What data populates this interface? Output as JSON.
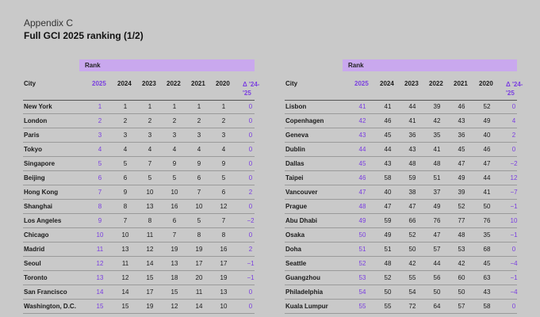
{
  "header": {
    "appendix": "Appendix C",
    "title": "Full GCI 2025 ranking (1/2)"
  },
  "table": {
    "rank_label": "Rank",
    "city_label": "City",
    "columns": [
      "2025",
      "2024",
      "2023",
      "2022",
      "2021",
      "2020",
      "Δ '24-'25"
    ],
    "left_rows": [
      {
        "city": "New York",
        "v": [
          "1",
          "1",
          "1",
          "1",
          "1",
          "1",
          "0"
        ]
      },
      {
        "city": "London",
        "v": [
          "2",
          "2",
          "2",
          "2",
          "2",
          "2",
          "0"
        ]
      },
      {
        "city": "Paris",
        "v": [
          "3",
          "3",
          "3",
          "3",
          "3",
          "3",
          "0"
        ]
      },
      {
        "city": "Tokyo",
        "v": [
          "4",
          "4",
          "4",
          "4",
          "4",
          "4",
          "0"
        ]
      },
      {
        "city": "Singapore",
        "v": [
          "5",
          "5",
          "7",
          "9",
          "9",
          "9",
          "0"
        ]
      },
      {
        "city": "Beijing",
        "v": [
          "6",
          "6",
          "5",
          "5",
          "6",
          "5",
          "0"
        ]
      },
      {
        "city": "Hong Kong",
        "v": [
          "7",
          "9",
          "10",
          "10",
          "7",
          "6",
          "2"
        ]
      },
      {
        "city": "Shanghai",
        "v": [
          "8",
          "8",
          "13",
          "16",
          "10",
          "12",
          "0"
        ]
      },
      {
        "city": "Los Angeles",
        "v": [
          "9",
          "7",
          "8",
          "6",
          "5",
          "7",
          "−2"
        ]
      },
      {
        "city": "Chicago",
        "v": [
          "10",
          "10",
          "11",
          "7",
          "8",
          "8",
          "0"
        ]
      },
      {
        "city": "Madrid",
        "v": [
          "11",
          "13",
          "12",
          "19",
          "19",
          "16",
          "2"
        ]
      },
      {
        "city": "Seoul",
        "v": [
          "12",
          "11",
          "14",
          "13",
          "17",
          "17",
          "−1"
        ]
      },
      {
        "city": "Toronto",
        "v": [
          "13",
          "12",
          "15",
          "18",
          "20",
          "19",
          "−1"
        ]
      },
      {
        "city": "San Francisco",
        "v": [
          "14",
          "14",
          "17",
          "15",
          "11",
          "13",
          "0"
        ]
      },
      {
        "city": "Washington, D.C.",
        "v": [
          "15",
          "15",
          "19",
          "12",
          "14",
          "10",
          "0"
        ]
      }
    ],
    "right_rows": [
      {
        "city": "Lisbon",
        "v": [
          "41",
          "41",
          "44",
          "39",
          "46",
          "52",
          "0"
        ]
      },
      {
        "city": "Copenhagen",
        "v": [
          "42",
          "46",
          "41",
          "42",
          "43",
          "49",
          "4"
        ]
      },
      {
        "city": "Geneva",
        "v": [
          "43",
          "45",
          "36",
          "35",
          "36",
          "40",
          "2"
        ]
      },
      {
        "city": "Dublin",
        "v": [
          "44",
          "44",
          "43",
          "41",
          "45",
          "46",
          "0"
        ]
      },
      {
        "city": "Dallas",
        "v": [
          "45",
          "43",
          "48",
          "48",
          "47",
          "47",
          "−2"
        ]
      },
      {
        "city": "Taipei",
        "v": [
          "46",
          "58",
          "59",
          "51",
          "49",
          "44",
          "12"
        ]
      },
      {
        "city": "Vancouver",
        "v": [
          "47",
          "40",
          "38",
          "37",
          "39",
          "41",
          "−7"
        ]
      },
      {
        "city": "Prague",
        "v": [
          "48",
          "47",
          "47",
          "49",
          "52",
          "50",
          "−1"
        ]
      },
      {
        "city": "Abu Dhabi",
        "v": [
          "49",
          "59",
          "66",
          "76",
          "77",
          "76",
          "10"
        ]
      },
      {
        "city": "Osaka",
        "v": [
          "50",
          "49",
          "52",
          "47",
          "48",
          "35",
          "−1"
        ]
      },
      {
        "city": "Doha",
        "v": [
          "51",
          "51",
          "50",
          "57",
          "53",
          "68",
          "0"
        ]
      },
      {
        "city": "Seattle",
        "v": [
          "52",
          "48",
          "42",
          "44",
          "42",
          "45",
          "−4"
        ]
      },
      {
        "city": "Guangzhou",
        "v": [
          "53",
          "52",
          "55",
          "56",
          "60",
          "63",
          "−1"
        ]
      },
      {
        "city": "Philadelphia",
        "v": [
          "54",
          "50",
          "54",
          "50",
          "50",
          "43",
          "−4"
        ]
      },
      {
        "city": "Kuala Lumpur",
        "v": [
          "55",
          "55",
          "72",
          "64",
          "57",
          "58",
          "0"
        ]
      }
    ]
  }
}
